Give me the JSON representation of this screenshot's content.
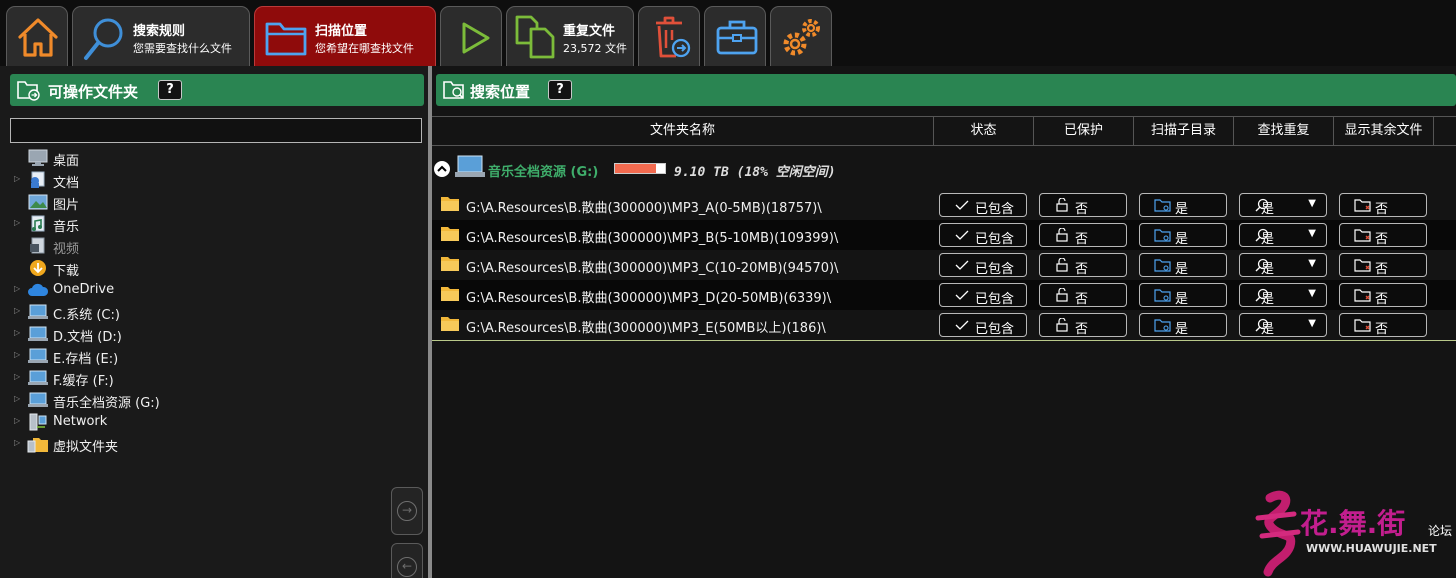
{
  "toolbar": {
    "tabs": [
      {
        "id": "home",
        "icon": "home-icon"
      },
      {
        "id": "search-rules",
        "title": "搜索规则",
        "subtitle": "您需要查找什么文件",
        "icon": "magnifier-icon"
      },
      {
        "id": "scan-location",
        "title": "扫描位置",
        "subtitle": "您希望在哪查找文件",
        "icon": "folder-icon",
        "active": true
      },
      {
        "id": "start",
        "icon": "play-icon"
      },
      {
        "id": "duplicates",
        "title": "重复文件",
        "subtitle": "23,572 文件",
        "icon": "copy-files-icon"
      },
      {
        "id": "delete",
        "icon": "trash-icon"
      },
      {
        "id": "toolbox",
        "icon": "toolbox-icon"
      },
      {
        "id": "settings",
        "icon": "gears-icon"
      }
    ]
  },
  "left": {
    "title": "可操作文件夹",
    "help": "?",
    "path_value": "",
    "tree": [
      {
        "label": "桌面",
        "icon": "desktop-icon",
        "expandable": false
      },
      {
        "label": "文档",
        "icon": "documents-icon",
        "expandable": true
      },
      {
        "label": "图片",
        "icon": "pictures-icon",
        "expandable": false
      },
      {
        "label": "音乐",
        "icon": "music-icon",
        "expandable": true
      },
      {
        "label": "视频",
        "icon": "video-icon",
        "expandable": false,
        "dim": true
      },
      {
        "label": "下载",
        "icon": "download-icon",
        "expandable": false
      },
      {
        "label": "OneDrive",
        "icon": "cloud-icon",
        "expandable": true
      },
      {
        "label": "C.系统 (C:)",
        "icon": "drive-icon",
        "expandable": true
      },
      {
        "label": "D.文档 (D:)",
        "icon": "drive-icon",
        "expandable": true
      },
      {
        "label": "E.存档 (E:)",
        "icon": "drive-icon",
        "expandable": true
      },
      {
        "label": "F.缓存 (F:)",
        "icon": "drive-icon",
        "expandable": true
      },
      {
        "label": "音乐全档资源 (G:)",
        "icon": "drive-icon",
        "expandable": true
      },
      {
        "label": "Network",
        "icon": "network-icon",
        "expandable": true
      },
      {
        "label": "虚拟文件夹",
        "icon": "virtual-folder-icon",
        "expandable": true
      }
    ]
  },
  "right": {
    "title": "搜索位置",
    "help": "?",
    "columns": [
      "文件夹名称",
      "状态",
      "已保护",
      "扫描子目录",
      "查找重复",
      "显示其余文件"
    ],
    "drive": {
      "name": "音乐全档资源 (G:)",
      "usage_text": "9.10 TB (18% 空闲空间)",
      "used_fraction": 0.82
    },
    "rows": [
      {
        "path": "G:\\A.Resources\\B.散曲(300000)\\MP3_A(0-5MB)(18757)\\",
        "status": "已包含",
        "protected": "否",
        "subdirs": "是",
        "find_dup": "是",
        "show_rest": "否"
      },
      {
        "path": "G:\\A.Resources\\B.散曲(300000)\\MP3_B(5-10MB)(109399)\\",
        "status": "已包含",
        "protected": "否",
        "subdirs": "是",
        "find_dup": "是",
        "show_rest": "否"
      },
      {
        "path": "G:\\A.Resources\\B.散曲(300000)\\MP3_C(10-20MB)(94570)\\",
        "status": "已包含",
        "protected": "否",
        "subdirs": "是",
        "find_dup": "是",
        "show_rest": "否"
      },
      {
        "path": "G:\\A.Resources\\B.散曲(300000)\\MP3_D(20-50MB)(6339)\\",
        "status": "已包含",
        "protected": "否",
        "subdirs": "是",
        "find_dup": "是",
        "show_rest": "否"
      },
      {
        "path": "G:\\A.Resources\\B.散曲(300000)\\MP3_E(50MB以上)(186)\\",
        "status": "已包含",
        "protected": "否",
        "subdirs": "是",
        "find_dup": "是",
        "show_rest": "否"
      }
    ]
  },
  "watermark": {
    "name": "花.舞.街",
    "suffix": "论坛",
    "url": "WWW.HUAWUJIE.NET"
  },
  "colors": {
    "accent_green": "#2a8552",
    "active_tab": "#8f0b0b",
    "folder_yellow": "#f2b83a",
    "usage_bar": "#f26a4f"
  }
}
